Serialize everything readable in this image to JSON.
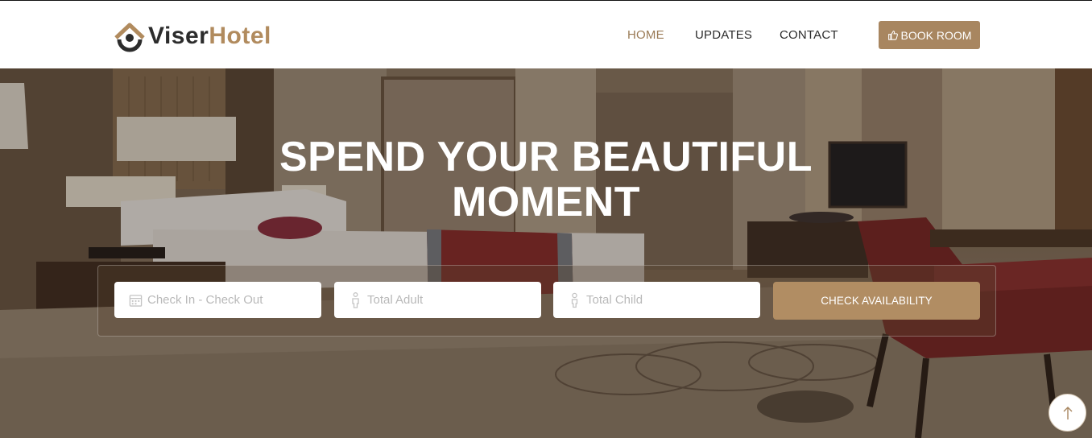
{
  "brand": {
    "part1": "Viser",
    "part2": "Hotel",
    "accent": "#b18b5e"
  },
  "nav": {
    "items": [
      {
        "label": "HOME",
        "active": true
      },
      {
        "label": "UPDATES",
        "active": false
      },
      {
        "label": "CONTACT",
        "active": false
      }
    ],
    "book_button": {
      "label": "BOOK ROOM",
      "icon": "thumbs-up-icon"
    }
  },
  "hero": {
    "title_line1": "SPEND YOUR BEAUTIFUL",
    "title_line2": "MOMENT"
  },
  "search": {
    "dates": {
      "placeholder": "Check In - Check Out",
      "icon": "calendar-icon"
    },
    "adults": {
      "placeholder": "Total Adult",
      "icon": "person-icon"
    },
    "children": {
      "placeholder": "Total Child",
      "icon": "child-icon"
    },
    "submit_label": "CHECK AVAILABILITY"
  },
  "scroll_top": {
    "icon": "arrow-up-icon"
  }
}
